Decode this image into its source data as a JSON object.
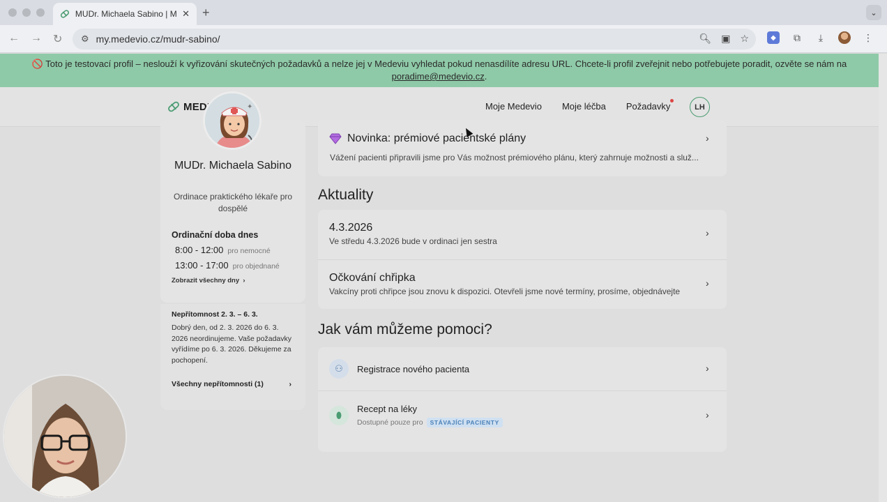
{
  "browser": {
    "tab_title": "MUDr. Michaela Sabino | Medevio",
    "tab_close": "✕",
    "new_tab": "+",
    "url": "my.medevio.cz/mudr-sabino/",
    "back": "←",
    "forward": "→",
    "reload": "↻"
  },
  "banner": {
    "text_line1": "Toto je testovací profil – neslouží k vyřizování skutečných požadavků a nelze jej v Medeviu vyhledat pokud nenasdílíte adresu URL. Chcete-li profil zveřejnit nebo potřebujete poradit, ozvěte se nám na",
    "email": "poradime@medevio.cz",
    "text_end": "."
  },
  "header": {
    "logo": "MEDEVIO",
    "nav": [
      "Moje Medevio",
      "Moje léčba",
      "Požadavky"
    ],
    "avatar_initials": "LH"
  },
  "doctor": {
    "name": "MUDr. Michaela Sabino",
    "specialty": "Ordinace praktického lékaře pro dospělé",
    "hours_title": "Ordinační doba dnes",
    "hours": [
      {
        "time": "8:00 - 12:00",
        "note": "pro nemocné"
      },
      {
        "time": "13:00 - 17:00",
        "note": "pro objednané"
      }
    ],
    "all_days": "Zobrazit všechny dny"
  },
  "absence": {
    "title": "Nepřítomnost 2. 3. – 6. 3.",
    "text": "Dobrý den, od 2. 3. 2026 do 6. 3. 2026 neordinujeme. Vaše požadavky vyřídíme po 6. 3. 2026. Děkujeme za pochopení.",
    "link": "Všechny nepřítomnosti (1)"
  },
  "promo": {
    "title": "Novinka: prémiové pacientské plány",
    "text": "Vážení pacienti připravili jsme pro Vás možnost prémiového plánu, který zahrnuje možnosti a služ..."
  },
  "news": {
    "title": "Aktuality",
    "items": [
      {
        "title": "4.3.2026",
        "text": "Ve středu 4.3.2026 bude v ordinaci jen sestra"
      },
      {
        "title": "Očkování chřipka",
        "text": "Vakcíny proti chřipce jsou znovu k dispozici. Otevřeli jsme nové termíny, prosíme, objednávejte"
      }
    ]
  },
  "help": {
    "title": "Jak vám můžeme pomoci?",
    "items": [
      {
        "title": "Registrace nového pacienta"
      },
      {
        "title": "Recept na léky",
        "sub": "Dostupné pouze pro",
        "badge": "STÁVAJÍCÍ PACIENTY"
      }
    ]
  },
  "colors": {
    "banner": "#8fcaa8",
    "accent_green": "#4b9c72",
    "badge_bg": "#cfe0f1",
    "badge_text": "#4a80b8"
  }
}
